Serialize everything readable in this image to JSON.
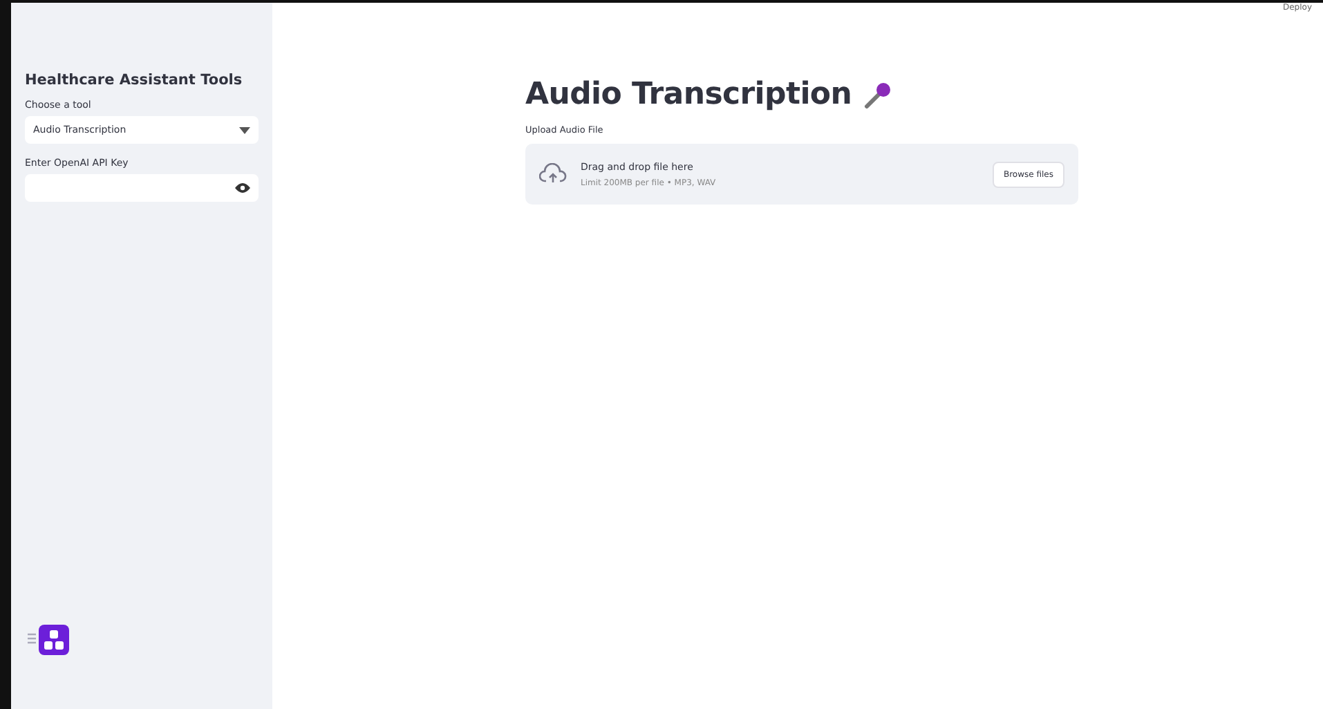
{
  "toolbar": {
    "deploy": "Deploy"
  },
  "sidebar": {
    "title": "Healthcare Assistant Tools",
    "tool_select": {
      "label": "Choose a tool",
      "value": "Audio Transcription"
    },
    "api_key": {
      "label": "Enter OpenAI API Key"
    }
  },
  "main": {
    "title": "Audio Transcription",
    "uploader": {
      "label": "Upload Audio File",
      "prompt": "Drag and drop file here",
      "limit": "Limit 200MB per file • MP3, WAV",
      "button": "Browse files"
    }
  }
}
